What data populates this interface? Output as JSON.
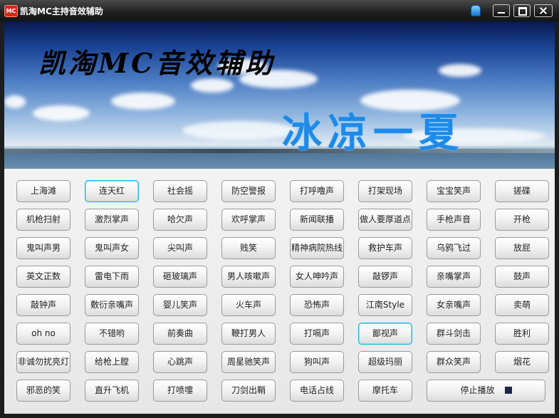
{
  "window": {
    "title": "凯淘MC主持音效辅助",
    "app_icon_label": "MC"
  },
  "banner": {
    "title": "凯淘MC音效辅助",
    "slogan": "冰凉一夏"
  },
  "buttons": {
    "b00": "上海滩",
    "b01": "连天红",
    "b02": "社会摇",
    "b03": "防空警报",
    "b04": "打呼噜声",
    "b05": "打架现场",
    "b06": "宝宝笑声",
    "b07": "搓碟",
    "b10": "机枪扫射",
    "b11": "激烈掌声",
    "b12": "哈欠声",
    "b13": "欢呼掌声",
    "b14": "新闻联播",
    "b15": "做人要厚道点",
    "b16": "手枪声音",
    "b17": "开枪",
    "b20": "鬼叫声男",
    "b21": "鬼叫声女",
    "b22": "尖叫声",
    "b23": "贱笑",
    "b24": "精神病院热线",
    "b25": "救护车声",
    "b26": "乌鸦飞过",
    "b27": "放屁",
    "b30": "英文正数",
    "b31": "雷电下雨",
    "b32": "砸玻璃声",
    "b33": "男人咳嗽声",
    "b34": "女人呻吟声",
    "b35": "敲锣声",
    "b36": "亲嘴掌声",
    "b37": "鼓声",
    "b40": "敲钟声",
    "b41": "敷衍亲嘴声",
    "b42": "婴儿笑声",
    "b43": "火车声",
    "b44": "恐怖声",
    "b45": "江南Style",
    "b46": "女亲嘴声",
    "b47": "卖萌",
    "b50": "oh no",
    "b51": "不错哟",
    "b52": "前奏曲",
    "b53": "鞭打男人",
    "b54": "打嗝声",
    "b55": "鄙视声",
    "b56": "群斗剑击",
    "b57": "胜利",
    "b60": "非诚勿扰亮灯",
    "b61": "给枪上膛",
    "b62": "心跳声",
    "b63": "周星驰笑声",
    "b64": "狗叫声",
    "b65": "超级玛丽",
    "b66": "群众笑声",
    "b67": "烟花",
    "b70": "邪恶的笑",
    "b71": "直升飞机",
    "b72": "打喷嚏",
    "b73": "刀剑出鞘",
    "b74": "电话占线",
    "b75": "摩托车"
  },
  "stop_button": {
    "label": "停止播放"
  },
  "colors": {
    "titlebar": "#1e1e1e",
    "highlight_border": "#19b3d9",
    "slogan": "#1e8ae8",
    "panel": "#ececec"
  },
  "icons": {
    "skin": "skin-shirt-icon",
    "minimize": "minimize-icon",
    "maximize": "maximize-icon",
    "close": "close-icon",
    "stop": "stop-square-icon"
  }
}
